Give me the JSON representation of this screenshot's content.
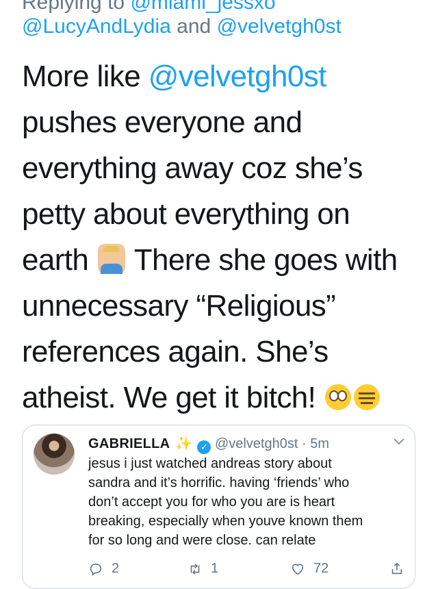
{
  "reply": {
    "prefix": "Replying to",
    "first_handle": "@miami_jessxo",
    "handle_1": "@LucyAndLydia",
    "and": "and",
    "handle_2": "@velvetgh0st"
  },
  "tweet": {
    "line1_before": "More like ",
    "line1_mention": "@velvetgh0st",
    "line2": "pushes everyone and",
    "line3": "everything away coz she’s",
    "line4": "petty about everything on",
    "line5_before": "earth",
    "line5_after": " There she goes with",
    "line6": "unnecessary “Religious”",
    "line7": "references again. She’s",
    "line8": "atheist. We get it bitch!",
    "emojis": [
      "man-tipping-hand-emoji",
      "rolling-eyes-emoji",
      "expressionless-face-emoji"
    ]
  },
  "quoted_tweet": {
    "name": "GABRIELLA",
    "sparkle": "✨",
    "verified": "✓",
    "handle": "@velvetgh0st",
    "separator": "·",
    "time": "5m",
    "lines": [
      "jesus i just watched andreas story about",
      "sandra and it’s horrific. having ‘friends’ who",
      "don’t accept you for who you are is heart",
      "breaking, especially when youve known them",
      "for so long and were close. can relate"
    ],
    "replies": "2",
    "retweets": "1",
    "likes": "72"
  },
  "colors": {
    "link": "#1da1f2",
    "muted": "#657786",
    "text": "#14171a"
  }
}
